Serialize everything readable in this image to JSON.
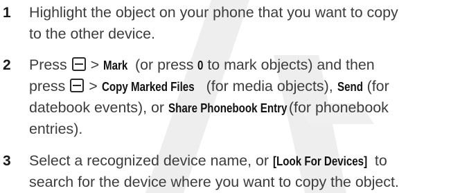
{
  "steps": [
    {
      "number": "1",
      "lines": [
        "Highlight the object on your phone that you want to copy",
        "to the other device."
      ]
    },
    {
      "number": "2",
      "press": "Press",
      "gt": ">",
      "mark": "Mark",
      "or_press": "(or press",
      "zero": "0",
      "to_mark": "to mark objects) and then",
      "press2": "press",
      "copy_marked": "Copy Marked Files",
      "for_media": "(for media objects),",
      "send": "Send",
      "for_line3": "(for",
      "datebook": "datebook events), or",
      "share": "Share Phonebook Entry",
      "for_phonebook": "(for phonebook",
      "entries": "entries)."
    },
    {
      "number": "3",
      "select": "Select a recognized device name, or",
      "look": "[Look For Devices]",
      "to": "to",
      "line2": "search for the device where you want to copy the object."
    }
  ],
  "icons": {
    "menu_key": "menu-key-icon"
  },
  "colors": {
    "text": "#3c3c3c",
    "keyword": "#111111",
    "watermark": "#ececec"
  }
}
